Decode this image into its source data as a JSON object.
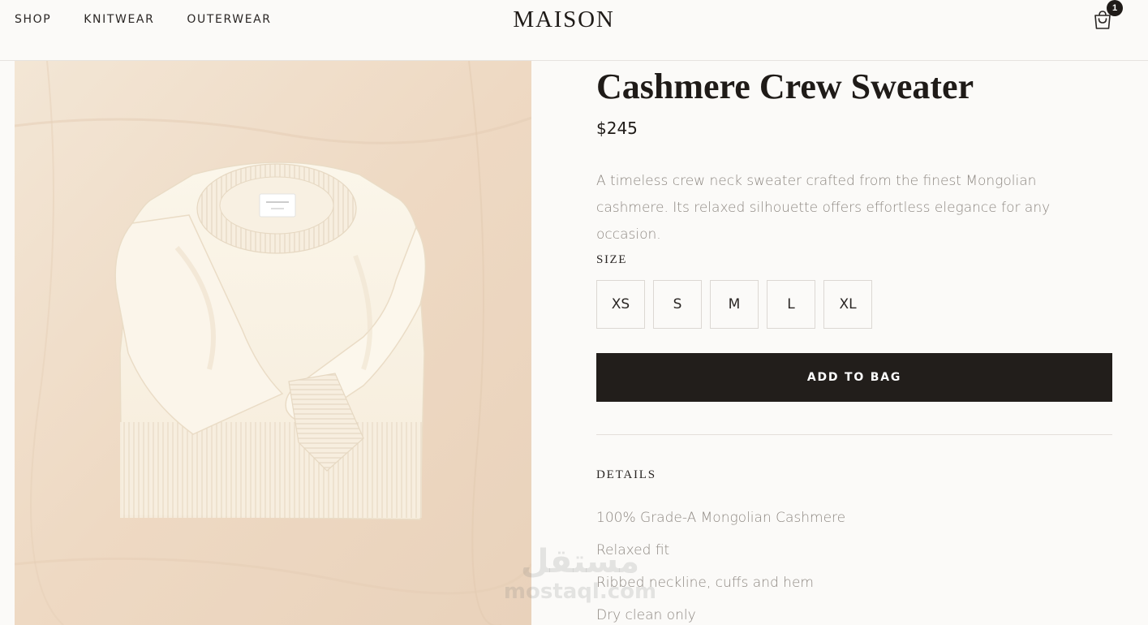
{
  "header": {
    "nav": [
      "SHOP",
      "KNITWEAR",
      "OUTERWEAR"
    ],
    "logo": "MAISON",
    "cart_count": "1"
  },
  "product": {
    "title": "Cashmere Crew Sweater",
    "price": "$245",
    "description": "A timeless crew neck sweater crafted from the finest Mongolian cashmere. Its relaxed silhouette offers effortless elegance for any occasion.",
    "size_label": "SIZE",
    "sizes": [
      "XS",
      "S",
      "M",
      "L",
      "XL"
    ],
    "add_to_bag": "ADD TO BAG",
    "details_heading": "DETAILS",
    "details": [
      "100% Grade-A Mongolian Cashmere",
      "Relaxed fit",
      "Ribbed neckline, cuffs and hem",
      "Dry clean only"
    ]
  },
  "watermark": {
    "arabic": "مستقل",
    "latin": "mostaql.com"
  },
  "colors": {
    "background": "#fbfaf8",
    "button": "#221e1b",
    "muted_text": "#8e8882",
    "image_bg": "#f0dcc7",
    "sweater": "#faf3e6"
  }
}
